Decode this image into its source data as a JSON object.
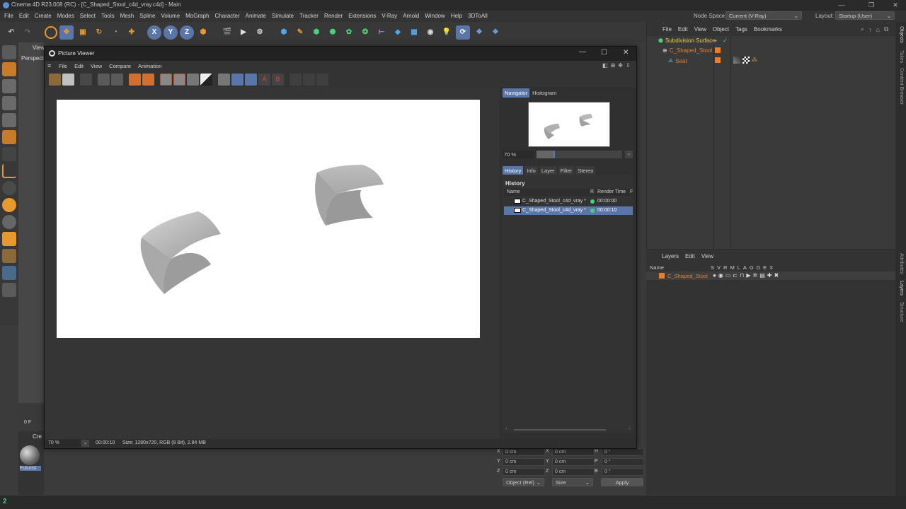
{
  "window": {
    "title": "Cinema 4D R23.008 (RC) - [C_Shaped_Stool_c4d_vray.c4d] - Main"
  },
  "menubar": {
    "items": [
      "File",
      "Edit",
      "Create",
      "Modes",
      "Select",
      "Tools",
      "Mesh",
      "Spline",
      "Volume",
      "MoGraph",
      "Character",
      "Animate",
      "Simulate",
      "Tracker",
      "Render",
      "Extensions",
      "V-Ray",
      "Arnold",
      "Window",
      "Help",
      "3DToAll"
    ],
    "node_space_label": "Node Space:",
    "node_space_value": "Current (V-Ray)",
    "layout_label": "Layout:",
    "layout_value": "Startup (User)"
  },
  "toolbar": {
    "axis_buttons": [
      "X",
      "Y",
      "Z"
    ]
  },
  "viewport": {
    "menu_label": "View",
    "camera_label": "Perspective",
    "frame_field": "0 F",
    "content_browser_label": "Cre",
    "material_label": "Futurist"
  },
  "picture_viewer": {
    "title": "Picture Viewer",
    "menu_items": [
      "File",
      "Edit",
      "View",
      "Compare",
      "Animation"
    ],
    "nav_tabs": [
      "Navigator",
      "Histogram"
    ],
    "zoom": "70 %",
    "info_tabs": [
      "History",
      "Info",
      "Layer",
      "Filter",
      "Stereo"
    ],
    "history_title": "History",
    "history_columns": [
      "Name",
      "R",
      "Render Time",
      "F"
    ],
    "history_rows": [
      {
        "name": "C_Shaped_Stool_c4d_vray *",
        "time": "00:00:00"
      },
      {
        "name": "C_Shaped_Stool_c4d_vray *",
        "time": "00:00:10"
      }
    ],
    "status_zoom": "70 %",
    "status_time": "00:00:10",
    "status_size": "Size: 1280x720, RGB (8 Bit), 2.84 MB"
  },
  "objects_panel": {
    "menu_items": [
      "File",
      "Edit",
      "View",
      "Object",
      "Tags",
      "Bookmarks"
    ],
    "tree": [
      {
        "name": "Subdivision Surface",
        "color": "#e8d23a"
      },
      {
        "name": "C_Shaped_Stool",
        "color": "#e57f2f"
      },
      {
        "name": "Seat",
        "color": "#e57f2f"
      }
    ]
  },
  "layers_panel": {
    "menu_items": [
      "Layers",
      "Edit",
      "View"
    ],
    "columns_name": "Name",
    "columns_flags": [
      "S",
      "V",
      "R",
      "M",
      "L",
      "A",
      "G",
      "D",
      "E",
      "X"
    ],
    "rows": [
      {
        "name": "C_Shaped_Stool"
      }
    ]
  },
  "right_strip_tabs": [
    "Objects",
    "Takes",
    "Content Browser",
    "Attributes",
    "Layers",
    "Structure"
  ],
  "coordinates": {
    "rows": [
      {
        "a": "X",
        "av": "0 cm",
        "b": "X",
        "bv": "0 cm",
        "c": "H",
        "cv": "0 °"
      },
      {
        "a": "Y",
        "av": "0 cm",
        "b": "Y",
        "bv": "0 cm",
        "c": "P",
        "cv": "0 °"
      },
      {
        "a": "Z",
        "av": "0 cm",
        "b": "Z",
        "bv": "0 cm",
        "c": "B",
        "cv": "0 °"
      }
    ],
    "mode_dropdown": "Object (Rel)",
    "size_dropdown": "Size",
    "apply_label": "Apply"
  },
  "colors": {
    "accent": "#5a76a8",
    "orange_icon": "#e69a2e",
    "render_bg": "#ffffff"
  }
}
